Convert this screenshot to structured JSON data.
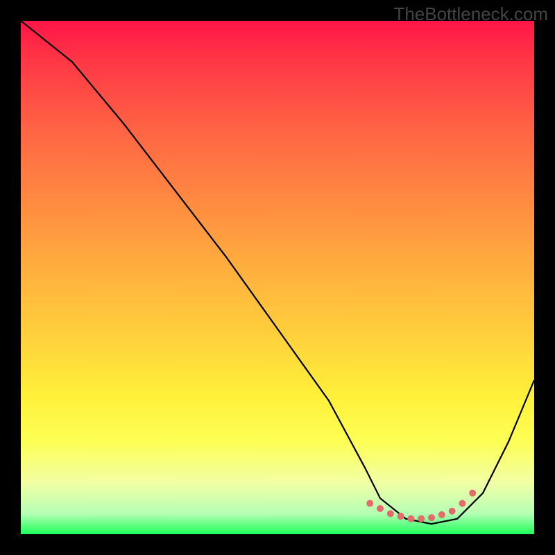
{
  "watermark": "TheBottleneck.com",
  "chart_data": {
    "type": "line",
    "title": "",
    "xlabel": "",
    "ylabel": "",
    "xlim": [
      0,
      100
    ],
    "ylim": [
      0,
      100
    ],
    "series": [
      {
        "name": "curve",
        "x": [
          0,
          10,
          20,
          30,
          40,
          50,
          60,
          67,
          70,
          75,
          80,
          85,
          90,
          95,
          100
        ],
        "y": [
          100,
          92,
          80,
          67,
          54,
          40,
          26,
          13,
          7,
          3,
          2,
          3,
          8,
          18,
          30
        ]
      }
    ],
    "markers": {
      "name": "valley-dots",
      "x": [
        68,
        70,
        72,
        74,
        76,
        78,
        80,
        82,
        84,
        86,
        88
      ],
      "y": [
        6,
        5,
        4,
        3.5,
        3,
        3,
        3.2,
        3.8,
        4.5,
        6,
        8
      ]
    },
    "colors": {
      "curve": "#000000",
      "markers": "#e56b6b",
      "gradient_top": "#ff1547",
      "gradient_bottom": "#1dff5a"
    }
  }
}
